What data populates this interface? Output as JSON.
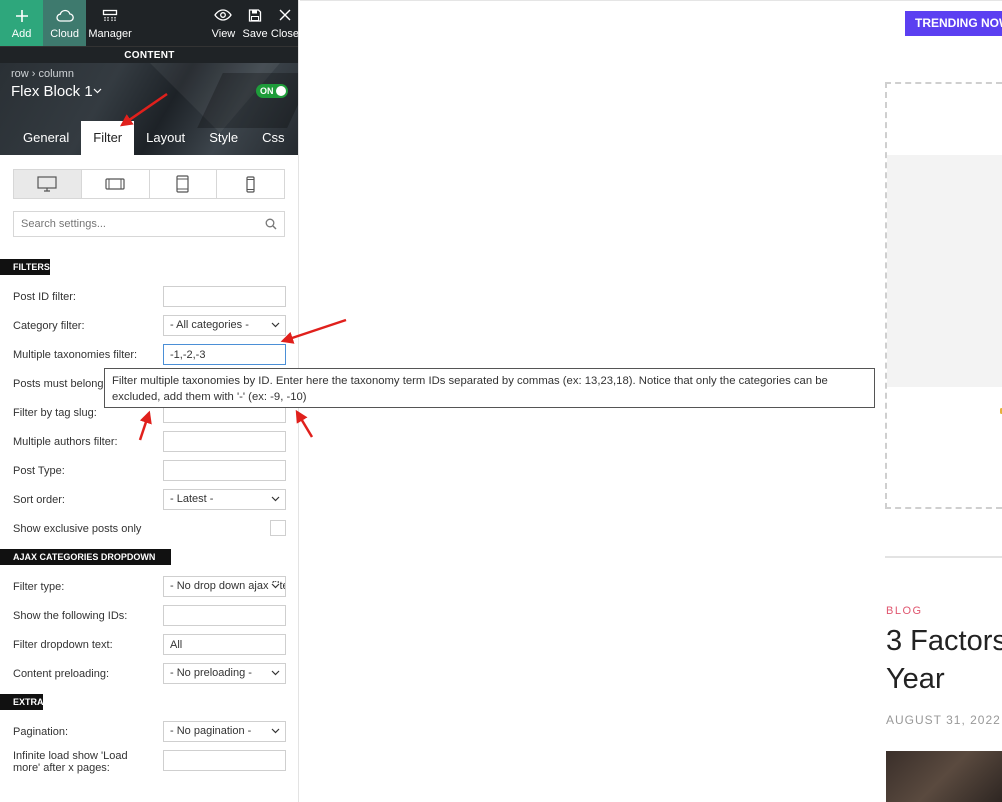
{
  "toolbar": {
    "add_label": "Add",
    "cloud_label": "Cloud",
    "manager_label": "Manager",
    "view_label": "View",
    "save_label": "Save",
    "close_label": "Close"
  },
  "panel": {
    "section_label": "CONTENT",
    "breadcrumb": "row › column",
    "block_title": "Flex Block 1",
    "toggle_label": "ON",
    "tabs": [
      {
        "label": "General"
      },
      {
        "label": "Filter"
      },
      {
        "label": "Layout"
      },
      {
        "label": "Style"
      },
      {
        "label": "Css"
      }
    ],
    "active_tab": "Filter",
    "devices": [
      "desktop-icon",
      "tablet-landscape-icon",
      "tablet-portrait-icon",
      "phone-icon"
    ],
    "search_placeholder": "Search settings..."
  },
  "filters": {
    "heading": "FILTERS",
    "post_id_label": "Post ID filter:",
    "post_id_value": "",
    "category_label": "Category filter:",
    "category_value": "- All categories -",
    "taxonomies_label": "Multiple taxonomies filter:",
    "taxonomies_value": "-1,-2,-3",
    "posts_belong_label": "Posts must belong",
    "tag_slug_label": "Filter by tag slug:",
    "authors_label": "Multiple authors filter:",
    "post_type_label": "Post Type:",
    "sort_order_label": "Sort order:",
    "sort_order_value": "- Latest -",
    "exclusive_label": "Show exclusive posts only"
  },
  "tooltip": {
    "text": "Filter multiple taxonomies by ID. Enter here the taxonomy term IDs separated by commas (ex: 13,23,18). Notice that only the categories can be excluded, add them with '-' (ex: -9, -10)"
  },
  "ajax": {
    "heading": "AJAX CATEGORIES DROPDOWN",
    "filter_type_label": "Filter type:",
    "filter_type_value": "- No drop down ajax filter -",
    "show_ids_label": "Show the following IDs:",
    "dropdown_text_label": "Filter dropdown text:",
    "dropdown_text_value": "All",
    "preloading_label": "Content preloading:",
    "preloading_value": "- No preloading -"
  },
  "extra": {
    "heading": "EXTRA",
    "pagination_label": "Pagination:",
    "pagination_value": "- No pagination -",
    "infinite_label_1": "Infinite load show 'Load",
    "infinite_label_2": "more' after x pages:"
  },
  "preview": {
    "trending_label": "TRENDING NOW",
    "category": "BLOG",
    "post_title_line1": "3 Factors",
    "post_title_line2": "Year",
    "post_date": "AUGUST 31, 2022"
  },
  "colors": {
    "toolbar_bg": "#1f2326",
    "add_bg": "#2ea77c",
    "cloud_bg": "#3e7a6e",
    "toggle_on": "#1e9c3a",
    "trending_bg": "#5b3ff1",
    "category_color": "#e0566f",
    "annotation_arrow": "#e0201c"
  }
}
